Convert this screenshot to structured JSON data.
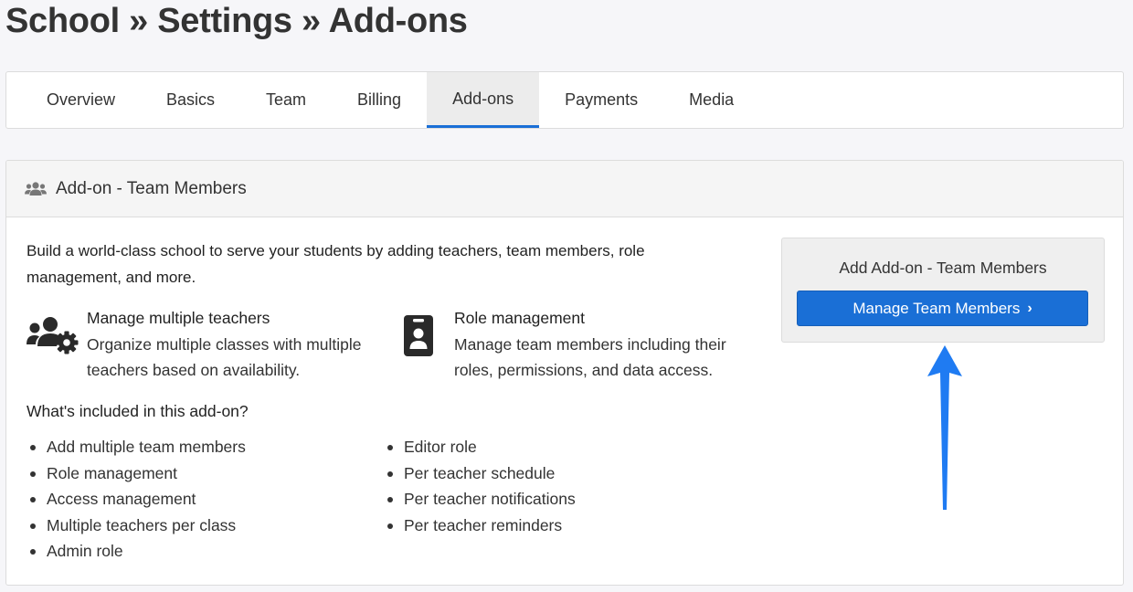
{
  "page": {
    "title": "School » Settings » Add-ons"
  },
  "tabs": [
    {
      "label": "Overview",
      "active": false
    },
    {
      "label": "Basics",
      "active": false
    },
    {
      "label": "Team",
      "active": false
    },
    {
      "label": "Billing",
      "active": false
    },
    {
      "label": "Add-ons",
      "active": true
    },
    {
      "label": "Payments",
      "active": false
    },
    {
      "label": "Media",
      "active": false
    }
  ],
  "panel": {
    "header_icon": "users-icon",
    "header_title": "Add-on - Team Members",
    "intro": "Build a world-class school to serve your students by adding teachers, team members, role management, and more.",
    "features": [
      {
        "icon": "users-gear-icon",
        "title": "Manage multiple teachers",
        "description": "Organize multiple classes with multiple teachers based on availability."
      },
      {
        "icon": "id-badge-icon",
        "title": "Role management",
        "description": "Manage team members including their roles, permissions, and data access."
      }
    ],
    "included_heading": "What's included in this add-on?",
    "included_left": [
      "Add multiple team members",
      "Role management",
      "Access management",
      "Multiple teachers per class",
      "Admin role"
    ],
    "included_right": [
      "Editor role",
      "Per teacher schedule",
      "Per teacher notifications",
      "Per teacher reminders"
    ]
  },
  "cta": {
    "title": "Add Add-on - Team Members",
    "button_label": "Manage Team Members",
    "button_icon": "chevron-right-icon"
  },
  "colors": {
    "accent": "#1a6fd6",
    "annotation_arrow": "#1f7bf2"
  }
}
